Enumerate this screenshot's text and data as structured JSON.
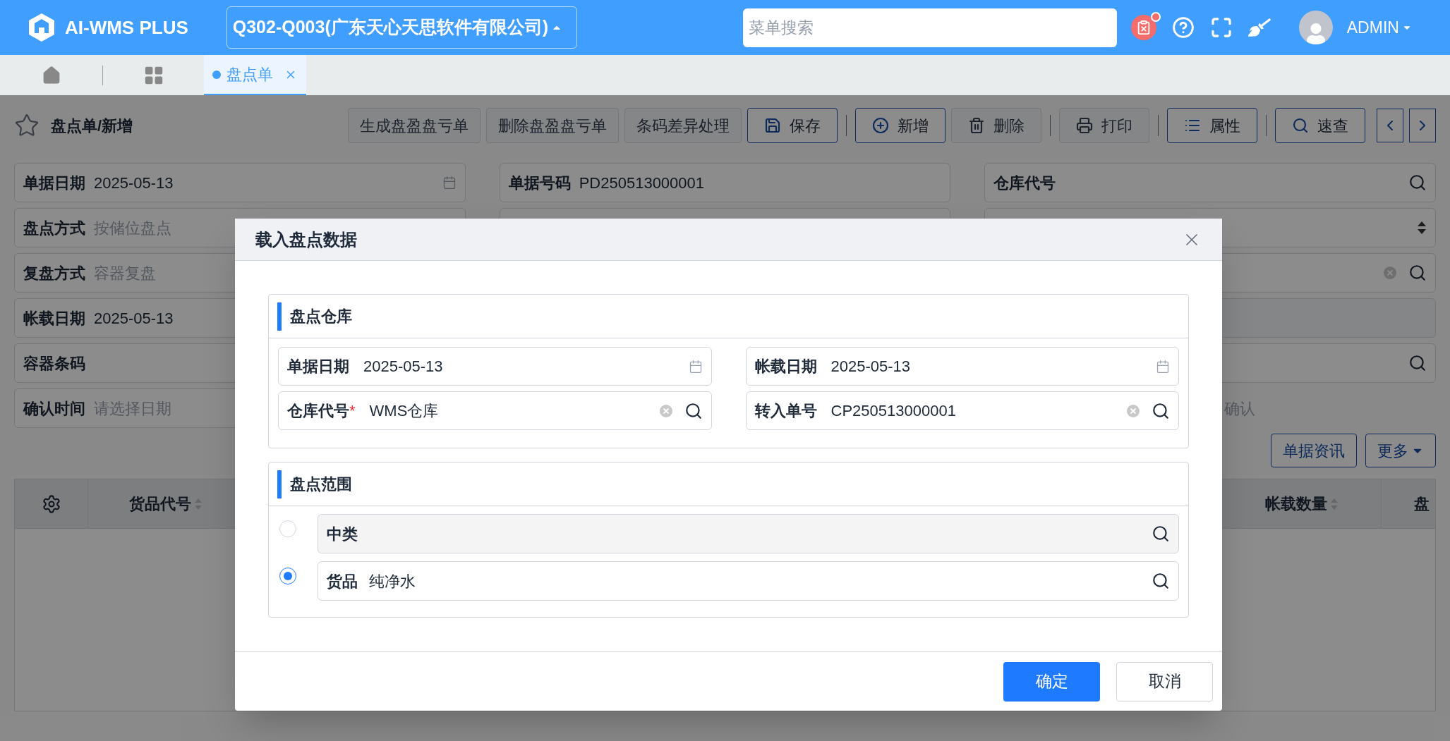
{
  "header": {
    "logo_text": "AI-WMS PLUS",
    "company": "Q302-Q003(广东天心天思软件有限公司)",
    "search": {
      "placeholder": "菜单搜索"
    },
    "user": "ADMIN",
    "notification_badge": true
  },
  "tabs": [
    {
      "label": "盘点单",
      "selected": true
    }
  ],
  "page": {
    "title": "盘点单/新增",
    "starred": false,
    "toolbar": [
      {
        "label": "生成盘盈盘亏单",
        "kind": "plain"
      },
      {
        "label": "删除盘盈盘亏单",
        "kind": "plain"
      },
      {
        "label": "条码差异处理",
        "kind": "plain"
      },
      {
        "label": "保存",
        "kind": "outline"
      },
      {
        "label": "新增",
        "kind": "outline"
      },
      {
        "label": "删除",
        "kind": "plain"
      },
      {
        "label": "打印",
        "kind": "plain"
      },
      {
        "label": "属性",
        "kind": "outline"
      },
      {
        "label": "速查",
        "kind": "outline"
      }
    ],
    "form_columns": [
      [
        {
          "label": "单据日期",
          "value": "2025-05-13",
          "kind": "date"
        },
        {
          "label": "盘点方式",
          "placeholder": "按储位盘点",
          "kind": "text"
        },
        {
          "label": "复盘方式",
          "placeholder": "容器复盘",
          "kind": "text"
        },
        {
          "label": "帐载日期",
          "value": "2025-05-13",
          "kind": "text"
        },
        {
          "label": "容器条码",
          "kind": "text"
        },
        {
          "label": "确认时间",
          "placeholder": "请选择日期",
          "kind": "text"
        }
      ],
      [
        {
          "label": "单据号码",
          "value": "PD250513000001",
          "kind": "text"
        },
        {
          "kind": "text"
        }
      ],
      [
        {
          "label": "仓库代号",
          "kind": "lookup"
        },
        {
          "kind": "spinner"
        },
        {
          "kind": "clear_lookup"
        },
        {
          "kind": "readonly"
        },
        {
          "kind": "lookup"
        },
        {
          "kind": "label",
          "value": "确认"
        }
      ]
    ],
    "actions": [
      "单据资讯",
      "更多"
    ],
    "table": {
      "columns": [
        "货品代号",
        "帐载数量",
        "盘"
      ]
    }
  },
  "dialog": {
    "title": "载入盘点数据",
    "sections": [
      {
        "title": "盘点仓库",
        "fields": [
          {
            "label": "单据日期",
            "value": "2025-05-13",
            "kind": "date"
          },
          {
            "label": "帐载日期",
            "value": "2025-05-13",
            "kind": "date"
          },
          {
            "label": "仓库代号",
            "required_mark": "*",
            "value": "WMS仓库",
            "kind": "clear_lookup"
          },
          {
            "label": "转入单号",
            "value": "CP250513000001",
            "kind": "clear_lookup"
          }
        ]
      },
      {
        "title": "盘点范围",
        "options": [
          {
            "label": "中类",
            "selected": false
          },
          {
            "label": "货品",
            "value": "纯净水",
            "selected": true
          }
        ]
      }
    ],
    "buttons": [
      {
        "label": "确定",
        "kind": "primary"
      },
      {
        "label": "取消",
        "kind": "plain"
      }
    ]
  }
}
